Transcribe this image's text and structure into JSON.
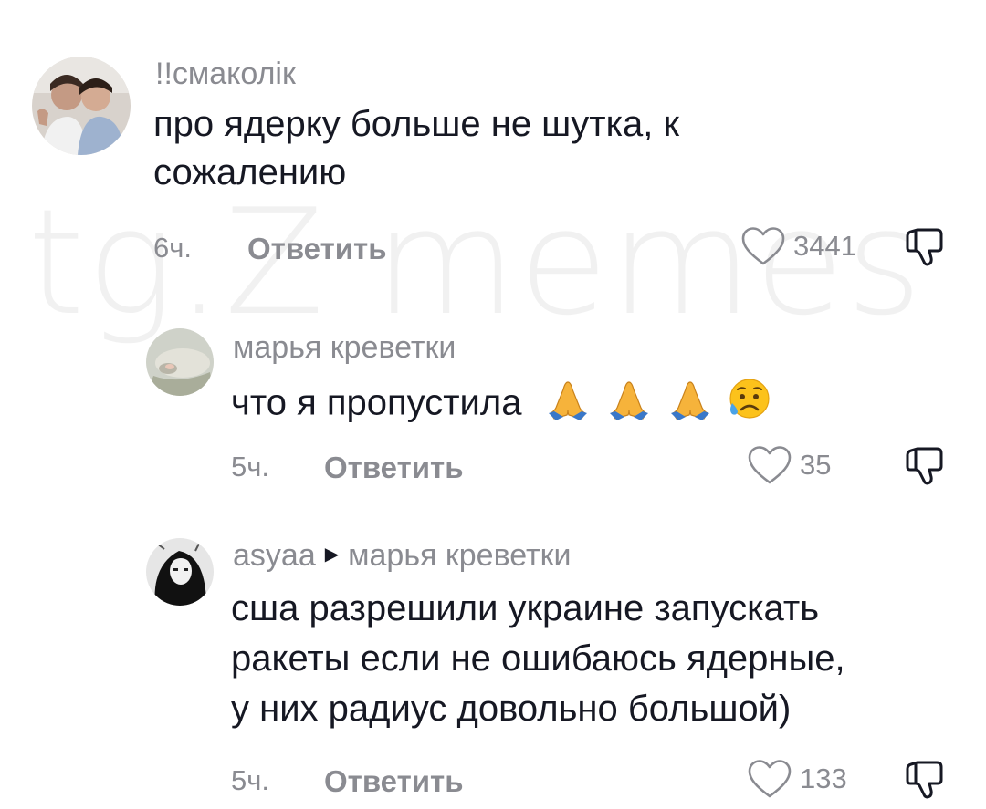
{
  "watermark": "tg.Z memes",
  "comments": [
    {
      "username": "!!смаколік",
      "text_line1": "про ядерку больше не шутка, к",
      "text_line2": "сожалению",
      "time": "6ч.",
      "reply_label": "Ответить",
      "likes": "3441"
    },
    {
      "username": "марья креветки",
      "text": "что я пропустила",
      "time": "5ч.",
      "reply_label": "Ответить",
      "likes": "35"
    },
    {
      "username": "asyaa",
      "reply_to": "марья креветки",
      "text_line1": "сша разрешили украине запускать",
      "text_line2": "ракеты если не ошибаюсь ядерные,",
      "text_line3": "у них радиус довольно большой)",
      "time": "5ч.",
      "reply_label": "Ответить",
      "likes": "133"
    }
  ],
  "icons": {
    "like": "heart-outline-icon",
    "dislike": "thumbs-down-icon",
    "reply_arrow": "caret-right-icon"
  },
  "colors": {
    "text": "#161823",
    "secondary": "#8a8b91",
    "background": "#ffffff"
  }
}
